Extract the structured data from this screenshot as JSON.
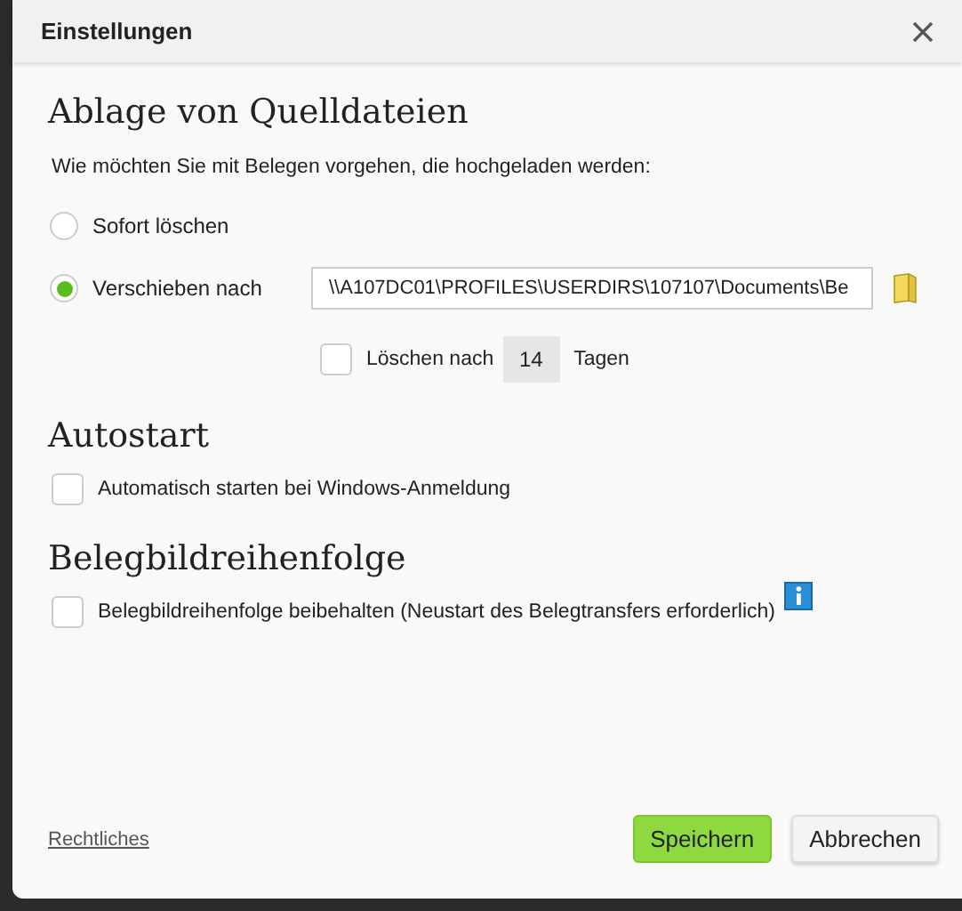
{
  "window": {
    "title": "Einstellungen"
  },
  "source_files": {
    "heading": "Ablage von Quelldateien",
    "question": "Wie möchten Sie mit Belegen vorgehen, die hochgeladen werden:",
    "options": [
      {
        "label": "Sofort löschen",
        "selected": false
      },
      {
        "label": "Verschieben nach",
        "selected": true
      }
    ],
    "path": {
      "value": "\\\\A107DC01\\PROFILES\\USERDIRS\\107107\\Documents\\Be"
    },
    "delete_after": {
      "checked": false,
      "label": "Löschen nach",
      "days": "14",
      "unit": "Tagen"
    }
  },
  "autostart": {
    "heading": "Autostart",
    "option": {
      "label": "Automatisch starten bei Windows-Anmeldung",
      "checked": false
    }
  },
  "image_order": {
    "heading": "Belegbildreihenfolge",
    "option": {
      "label": "Belegbildreihenfolge beibehalten (Neustart des Belegtransfers erforderlich)",
      "checked": false
    }
  },
  "footer": {
    "link": "Rechtliches",
    "buttons": [
      {
        "label": "Speichern",
        "kind": "primary"
      },
      {
        "label": "Abbrechen",
        "kind": "secondary"
      }
    ]
  }
}
